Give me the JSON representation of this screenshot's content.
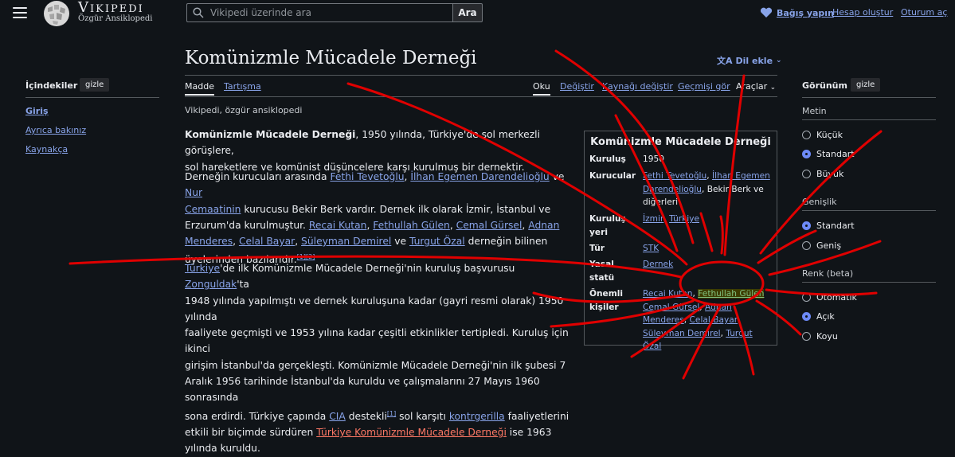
{
  "header": {
    "wordmark": "Vikipedi",
    "tagline": "Özgür Ansiklopedi",
    "search_placeholder": "Vikipedi üzerinde ara",
    "search_button": "Ara",
    "donate": "Bağış yapın",
    "create_account": "Hesap oluştur",
    "login": "Oturum aç"
  },
  "toc": {
    "title": "İçindekiler",
    "hide": "gizle",
    "items": [
      "Giriş",
      "Ayrıca bakınız",
      "Kaynakça"
    ]
  },
  "page": {
    "title": "Komünizmle Mücadele Derneği",
    "language_button": "Dil ekle",
    "tabs": {
      "article": "Madde",
      "talk": "Tartışma"
    },
    "actions": {
      "read": "Oku",
      "edit": "Değiştir",
      "edit_source": "Kaynağı değiştir",
      "history": "Geçmişi gör",
      "tools": "Araçlar"
    },
    "from": "Vikipedi, özgür ansiklopedi"
  },
  "article": {
    "p1_bold": "Komünizmle Mücadele Derneği",
    "p1_rest_line1": ", 1950 yılında, Türkiye'de sol merkezli görüşlere,",
    "p1_line2": "sol hareketlere ve komünist düşüncelere karşı kurulmuş bir dernektir.",
    "p2": {
      "t1": "Derneğin kurucuları arasında ",
      "l1": "Fethi Tevetoğlu",
      "t2": ", ",
      "l2": "İlhan Egemen Darendelioğlu",
      "t3": " ve ",
      "l3a": "Nur",
      "l3b": "Cemaatinin",
      "t4": " kurucusu Bekir Berk vardır. Dernek ilk olarak İzmir, İstanbul ve",
      "t5": "Erzurum'da kurulmuştur. ",
      "l4": "Recai Kutan",
      "l5": "Fethullah Gülen",
      "l6": "Cemal Gürsel",
      "l7a": "Adnan",
      "l7b": "Menderes",
      "l8": "Celal Bayar",
      "l9": "Süleyman Demirel",
      "t6": " ve ",
      "l10": "Turgut Özal",
      "t7": " derneğin bilinen",
      "t8": "üyelerinden bazılarıdır.",
      "refs": "[1][2]"
    },
    "p3": {
      "l1": "Türkiye",
      "t1": "'de ilk Komünizmle Mücadele Derneği'nin kuruluş başvurusu ",
      "l2": "Zonguldak",
      "t2": "'ta",
      "line2": "1948 yılında yapılmıştı ve dernek kuruluşuna kadar (gayri resmi olarak) 1950 yılında",
      "line3": "faaliyete geçmişti ve 1953 yılına kadar çeşitli etkinlikler tertipledi. Kuruluş için ikinci",
      "line4": "girişim İstanbul'da gerçekleşti. Komünizmle Mücadele Derneği'nin ilk şubesi 7",
      "line5": "Aralık 1956 tarihinde İstanbul'da kuruldu ve çalışmalarını 27 Mayıs 1960 sonrasında",
      "line6a": "sona erdirdi. Türkiye çapında ",
      "l3": "CIA",
      "line6b": " destekli",
      "ref": "[1]",
      "line6c": " sol karşıtı ",
      "l4": "kontrgerilla",
      "line6d": " faaliyetlerini",
      "line7a": "etkili bir biçimde sürdüren ",
      "l5": "Türkiye Komünizmle Mücadele Derneği",
      "line7b": " ise 1963 yılında kuruldu."
    }
  },
  "infobox": {
    "title": "Komünizmle Mücadele Derneği",
    "rows": {
      "founded_label": "Kuruluş",
      "founded_value": "1950",
      "founders_label": "Kurucular",
      "founders_l1": "Fethi Tevetoğlu",
      "founders_l2a": "İlhan Egemen",
      "founders_l2b": "Darendelioğlu",
      "founders_t": ", Bekir Berk ve",
      "founders_t2": "diğerleri",
      "place_label_1": "Kuruluş",
      "place_label_2": "yeri",
      "place_l1": "İzmir",
      "place_l2": "Türkiye",
      "type_label": "Tür",
      "type_value": "STK",
      "legal_label_1": "Yasal",
      "legal_label_2": "statü",
      "legal_value": "Dernek",
      "people_label_1": "Önemli",
      "people_label_2": "kişiler",
      "people": [
        "Recai Kutan",
        "Fethullah Gülen",
        "Cemal Gürsel",
        "Adnan",
        "Menderes",
        "Celal Bayar",
        "Süleyman Demirel",
        "Turgut Özal"
      ]
    }
  },
  "appearance": {
    "title": "Görünüm",
    "hide": "gizle",
    "text_section": "Metin",
    "text_options": [
      "Küçük",
      "Standart",
      "Büyük"
    ],
    "text_selected": "Standart",
    "width_section": "Genişlik",
    "width_options": [
      "Standart",
      "Geniş"
    ],
    "width_selected": "Standart",
    "color_section": "Renk (beta)",
    "color_options": [
      "Otomatik",
      "Açık",
      "Koyu"
    ],
    "color_selected": "Açık"
  },
  "colors": {
    "background": "#101418",
    "link": "#88a3e8",
    "red_link": "#fd7865",
    "annotation": "#e00000",
    "highlight": "#3d3d00"
  }
}
